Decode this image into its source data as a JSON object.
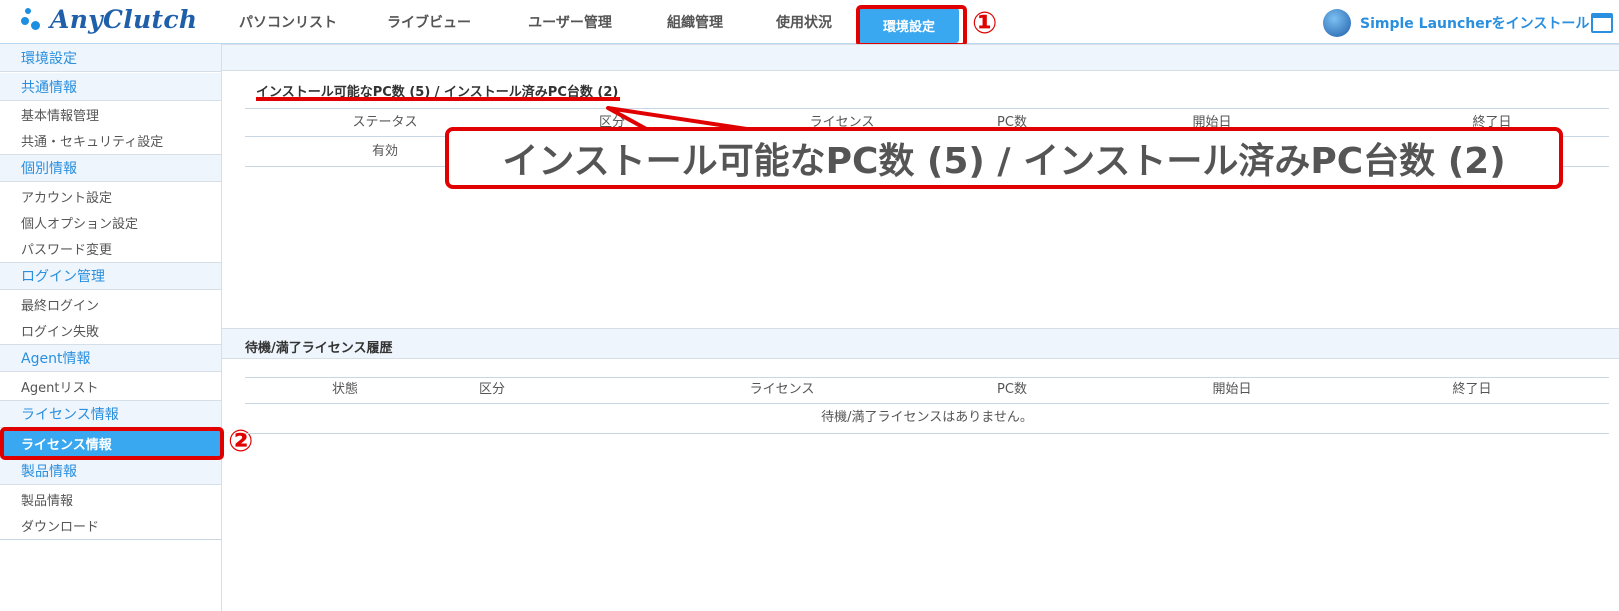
{
  "app": {
    "logo_text": "AnyClutch"
  },
  "nav": {
    "items": [
      "パソコンリスト",
      "ライブビュー",
      "ユーザー管理",
      "組織管理",
      "使用状況",
      "環境設定"
    ],
    "active": "環境設定"
  },
  "launcher": {
    "label": "Simple Launcherをインストール"
  },
  "annotations": {
    "marker1": "①",
    "marker2": "②",
    "callout": "インストール可能なPC数 (5) / インストール済みPC台数 (2)"
  },
  "sidebar": {
    "items": [
      {
        "label": "環境設定",
        "type": "header"
      },
      {
        "label": "共通情報",
        "type": "header"
      },
      {
        "label": "基本情報管理",
        "type": "item"
      },
      {
        "label": "共通・セキュリティ設定",
        "type": "item"
      },
      {
        "label": "個別情報",
        "type": "header"
      },
      {
        "label": "アカウント設定",
        "type": "item"
      },
      {
        "label": "個人オプション設定",
        "type": "item"
      },
      {
        "label": "パスワード変更",
        "type": "item"
      },
      {
        "label": "ログイン管理",
        "type": "header"
      },
      {
        "label": "最終ログイン",
        "type": "item"
      },
      {
        "label": "ログイン失敗",
        "type": "item"
      },
      {
        "label": "Agent情報",
        "type": "header"
      },
      {
        "label": "Agentリスト",
        "type": "item"
      },
      {
        "label": "ライセンス情報",
        "type": "header"
      },
      {
        "label": "ライセンス情報",
        "type": "active"
      },
      {
        "label": "製品情報",
        "type": "header"
      },
      {
        "label": "製品情報",
        "type": "item"
      },
      {
        "label": "ダウンロード",
        "type": "item"
      }
    ]
  },
  "license_section": {
    "title": "インストール可能なPC数 (5) / インストール済みPC台数 (2)",
    "columns": [
      "ステータス",
      "区分",
      "ライセンス",
      "PC数",
      "開始日",
      "終了日"
    ],
    "rows": [
      [
        "有効"
      ]
    ]
  },
  "history_section": {
    "title": "待機/満了ライセンス履歴",
    "columns": [
      "状態",
      "区分",
      "ライセンス",
      "PC数",
      "開始日",
      "終了日"
    ],
    "empty_message": "待機/満了ライセンスはありません。"
  }
}
